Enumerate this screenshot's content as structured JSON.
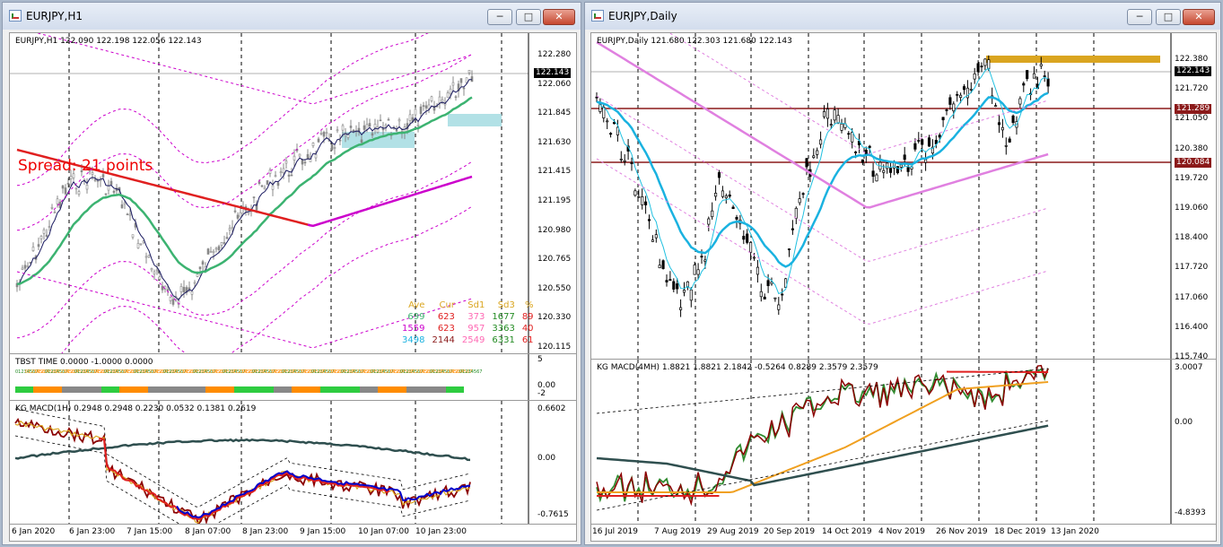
{
  "left_window": {
    "title": "EURJPY,H1",
    "info": "EURJPY,H1  122.090 122.198 122.056 122.143",
    "spread_text": "Spread: 21 points",
    "price_axis": [
      "122.280",
      "122.060",
      "121.845",
      "121.630",
      "121.415",
      "121.195",
      "120.980",
      "120.765",
      "120.550",
      "120.330",
      "120.115"
    ],
    "current_price": "122.143",
    "time_axis": [
      "6 Jan 2020",
      "6 Jan 23:00",
      "7 Jan 15:00",
      "8 Jan 07:00",
      "8 Jan 23:00",
      "9 Jan 15:00",
      "10 Jan 07:00",
      "10 Jan 23:00"
    ],
    "stats": {
      "headers": [
        "Ave",
        "Cur",
        "Sd1",
        "Sd3",
        "%"
      ],
      "rows": [
        [
          "699",
          "623",
          "373",
          "1677",
          "89"
        ],
        [
          "1559",
          "623",
          "957",
          "3363",
          "40"
        ],
        [
          "3498",
          "2144",
          "2549",
          "6331",
          "61"
        ]
      ]
    },
    "tbst_label": "TBST TIME 0.0000 -1.0000 0.0000",
    "tbst_axis": [
      "5",
      "0.00",
      "-2"
    ],
    "macd_label": "KG MACD(1H) 0.2948 0.2948 0.2230 0.0532 0.1381 0.2619",
    "macd_axis": [
      "0.6602",
      "0.00",
      "-0.7615"
    ]
  },
  "right_window": {
    "title": "EURJPY,Daily",
    "info": "EURJPY,Daily  121.680 122.303 121.680 122.143",
    "price_axis": [
      "122.380",
      "121.720",
      "121.050",
      "120.380",
      "119.720",
      "119.060",
      "118.400",
      "117.720",
      "117.060",
      "116.400",
      "115.740"
    ],
    "current_price": "122.143",
    "level_1": "121.289",
    "level_2": "120.084",
    "time_axis": [
      "16 Jul 2019",
      "7 Aug 2019",
      "29 Aug 2019",
      "20 Sep 2019",
      "14 Oct 2019",
      "4 Nov 2019",
      "26 Nov 2019",
      "18 Dec 2019",
      "13 Jan 2020"
    ],
    "macd_label": "KG MACD(4MH) 1.8821 1.8821 2.1842 -0.5264 0.8289 2.3579 2.3579",
    "macd_axis": [
      "3.0007",
      "0.00",
      "-4.8393"
    ]
  },
  "window_buttons": {
    "minimize": "─",
    "maximize": "□",
    "close": "✕"
  },
  "colors": {
    "bull": "#000000",
    "bear": "#ffffff",
    "ma_green": "#3cb371",
    "ma_red": "#e02020",
    "ma_magenta": "#cc00cc",
    "ma_cyan": "#1ab2e0",
    "band": "#cc00cc",
    "level": "#8b1a1a",
    "gold": "#daa520"
  }
}
